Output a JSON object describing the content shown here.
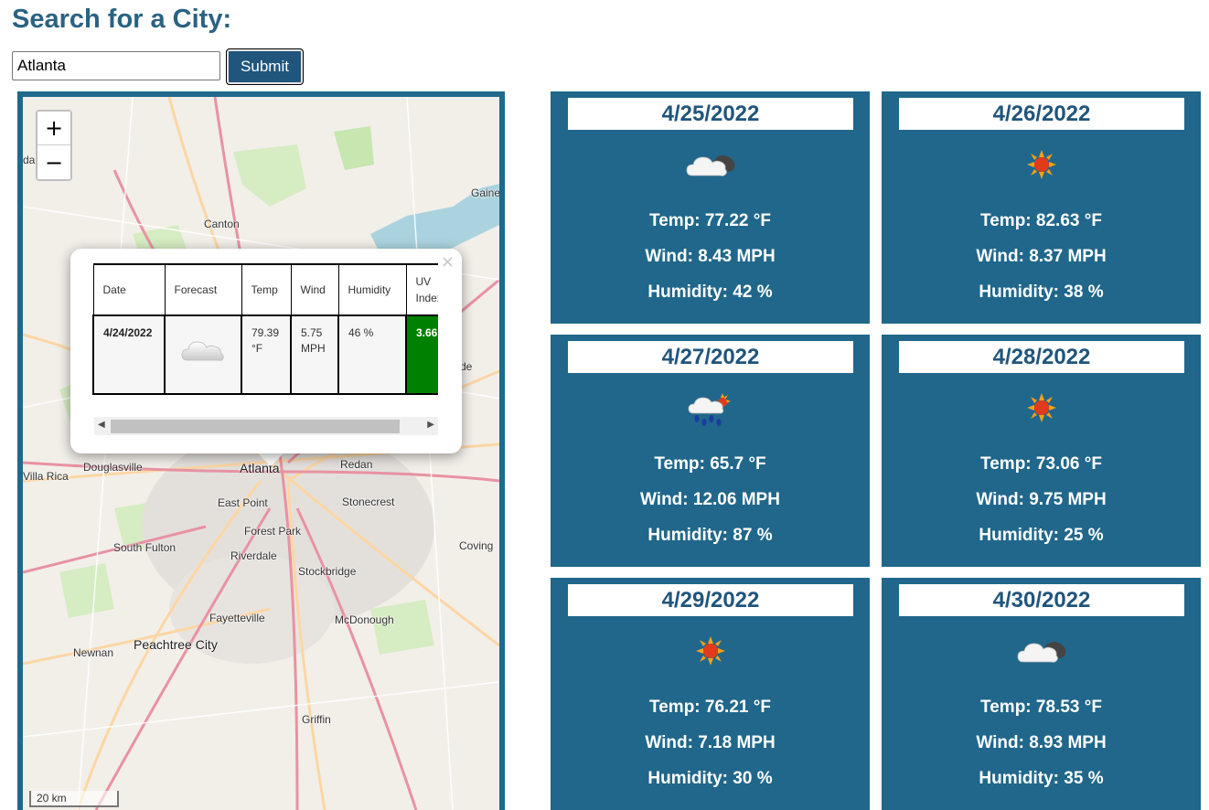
{
  "search": {
    "heading": "Search for a City:",
    "value": "Atlanta",
    "submit_label": "Submit"
  },
  "map": {
    "zoom_in": "+",
    "zoom_out": "−",
    "scale": "20 km",
    "labels": [
      "Canton",
      "Gaine",
      "Douglasville",
      "Villa Rica",
      "Atlanta",
      "Redan",
      "East Point",
      "Stonecrest",
      "Forest Park",
      "South Fulton",
      "Riverdale",
      "Coving",
      "Stockbridge",
      "Fayetteville",
      "McDonough",
      "Newnan",
      "Peachtree City",
      "Griffin",
      "dai",
      "de"
    ],
    "colors": {
      "land": "#f2efe9",
      "highway": "#e892a2",
      "primary": "#fcd6a4",
      "water": "#aad3df",
      "park": "#c8e6b0",
      "urban": "#dddddd"
    }
  },
  "popup": {
    "close": "×",
    "headers": [
      "Date",
      "Forecast",
      "Temp",
      "Wind",
      "Humidity",
      "UV Index"
    ],
    "row": {
      "date": "4/24/2022",
      "forecast_icon": "cloud-icon",
      "temp": "79.39 °F",
      "wind": "5.75 MPH",
      "humidity": "46 %",
      "uv": "3.66"
    },
    "uv_color": "#008000"
  },
  "forecast": [
    {
      "date": "4/25/2022",
      "icon": "partly-cloudy-night-icon",
      "temp": "Temp: 77.22 °F",
      "wind": "Wind: 8.43 MPH",
      "humidity": "Humidity: 42 %"
    },
    {
      "date": "4/26/2022",
      "icon": "sun-icon",
      "temp": "Temp: 82.63 °F",
      "wind": "Wind: 8.37 MPH",
      "humidity": "Humidity: 38 %"
    },
    {
      "date": "4/27/2022",
      "icon": "rain-sun-icon",
      "temp": "Temp: 65.7 °F",
      "wind": "Wind: 12.06 MPH",
      "humidity": "Humidity: 87 %"
    },
    {
      "date": "4/28/2022",
      "icon": "sun-icon",
      "temp": "Temp: 73.06 °F",
      "wind": "Wind: 9.75 MPH",
      "humidity": "Humidity: 25 %"
    },
    {
      "date": "4/29/2022",
      "icon": "sun-icon",
      "temp": "Temp: 76.21 °F",
      "wind": "Wind: 7.18 MPH",
      "humidity": "Humidity: 30 %"
    },
    {
      "date": "4/30/2022",
      "icon": "partly-cloudy-night-icon",
      "temp": "Temp: 78.53 °F",
      "wind": "Wind: 8.93 MPH",
      "humidity": "Humidity: 35 %"
    }
  ],
  "colors": {
    "accent": "#20678b",
    "heading": "#2a6282",
    "button": "#20557c"
  }
}
